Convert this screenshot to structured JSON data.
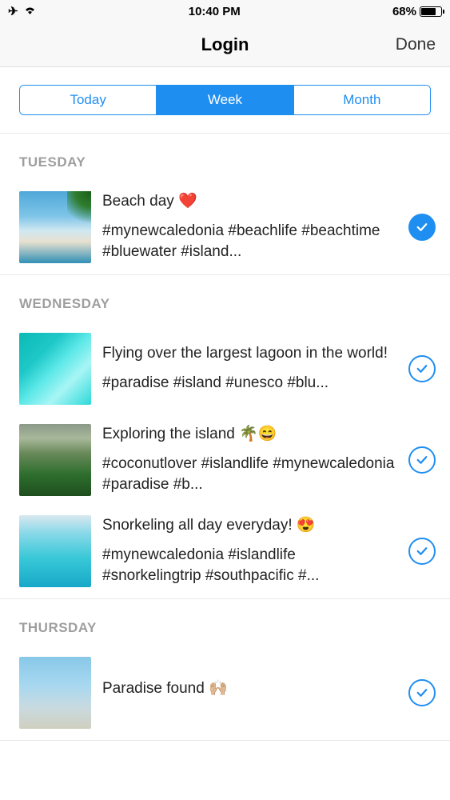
{
  "statusBar": {
    "time": "10:40 PM",
    "batteryPct": "68%"
  },
  "nav": {
    "title": "Login",
    "done": "Done"
  },
  "segments": {
    "today": "Today",
    "week": "Week",
    "month": "Month",
    "activeIndex": 1
  },
  "sections": [
    {
      "title": "TUESDAY",
      "posts": [
        {
          "caption": "Beach day ❤️",
          "tags": "#mynewcaledonia #beachlife #beachtime #bluewater #island...",
          "checkStyle": "filled",
          "thumbClass": "thumb-beach"
        }
      ]
    },
    {
      "title": "WEDNESDAY",
      "posts": [
        {
          "caption": "Flying over the largest lagoon in the world!",
          "tags": "#paradise #island #unesco #blu...",
          "checkStyle": "outline",
          "thumbClass": "thumb-lagoon"
        },
        {
          "caption": "Exploring the island 🌴😄",
          "tags": "#coconutlover #islandlife #mynewcaledonia #paradise #b...",
          "checkStyle": "outline",
          "thumbClass": "thumb-island"
        },
        {
          "caption": "Snorkeling all day everyday! 😍",
          "tags": "#mynewcaledonia #islandlife #snorkelingtrip #southpacific #...",
          "checkStyle": "outline",
          "thumbClass": "thumb-snorkel"
        }
      ]
    },
    {
      "title": "THURSDAY",
      "posts": [
        {
          "caption": "Paradise found 🙌🏼",
          "tags": "",
          "checkStyle": "outline",
          "thumbClass": "thumb-paradise"
        }
      ]
    }
  ]
}
